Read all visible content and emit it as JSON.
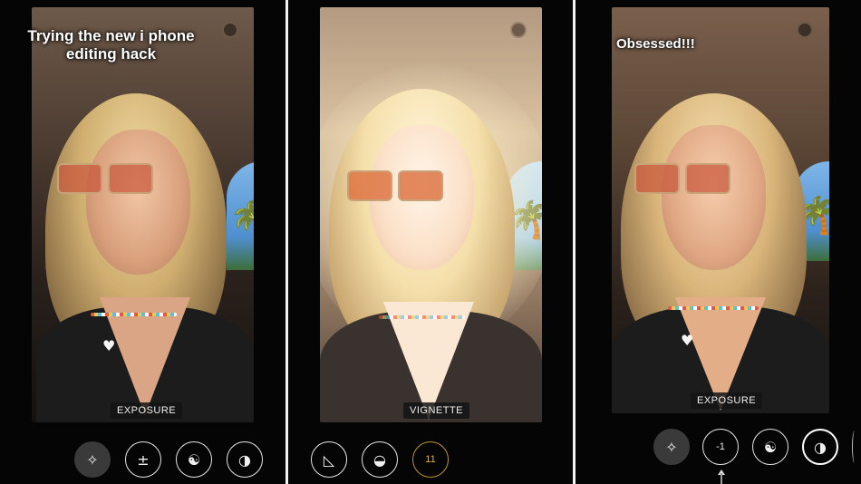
{
  "panels": [
    {
      "caption": "Trying the new i phone editing hack",
      "tool_label": "EXPOSURE",
      "tools": [
        {
          "icon": "magic-wand-icon",
          "glyph": "✧"
        },
        {
          "icon": "exposure-icon",
          "glyph": "±"
        },
        {
          "icon": "contrast-yinyang-icon",
          "glyph": "☯"
        },
        {
          "icon": "half-circle-icon",
          "glyph": "◑"
        }
      ]
    },
    {
      "caption": "",
      "tool_label": "VIGNETTE",
      "tools": [
        {
          "icon": "sharpness-triangle-icon",
          "glyph": "◺"
        },
        {
          "icon": "half-circle-icon",
          "glyph": "◒"
        },
        {
          "icon": "vignette-value",
          "value": "11"
        }
      ]
    },
    {
      "caption": "Obsessed!!!",
      "tool_label": "EXPOSURE",
      "tools": [
        {
          "icon": "magic-wand-icon",
          "glyph": "✧"
        },
        {
          "icon": "exposure-value",
          "value": "-1"
        },
        {
          "icon": "contrast-yinyang-icon",
          "glyph": "☯"
        },
        {
          "icon": "half-circle-icon",
          "glyph": "◑"
        }
      ]
    }
  ]
}
